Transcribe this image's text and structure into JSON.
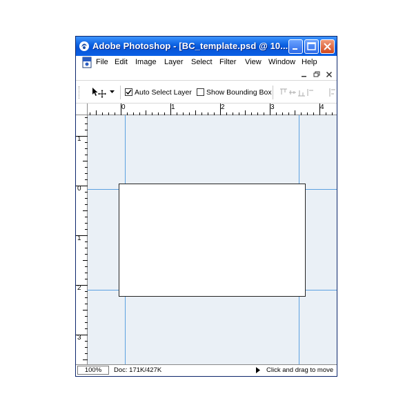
{
  "window": {
    "title": "Adobe Photoshop - [BC_template.psd @ 10..."
  },
  "menu": {
    "items": [
      "File",
      "Edit",
      "Image",
      "Layer",
      "Select",
      "Filter",
      "View",
      "Window",
      "Help"
    ]
  },
  "options": {
    "tool": "move-tool",
    "auto_select_label": "Auto Select Layer",
    "auto_select_checked": true,
    "bounding_box_label": "Show Bounding Box",
    "bounding_box_checked": false
  },
  "rulers": {
    "horizontal_labels": [
      "0",
      "1",
      "2",
      "3",
      "4"
    ],
    "vertical_labels": [
      "1",
      "0",
      "1",
      "2",
      "3"
    ]
  },
  "status": {
    "zoom": "100%",
    "doc": "Doc: 171K/427K",
    "hint": "Click and drag to move"
  },
  "colors": {
    "title_bar": "#0a5fe0",
    "canvas_bg": "#eaf0f6",
    "guide": "#5aa0e0",
    "close_button": "#d2471c"
  }
}
